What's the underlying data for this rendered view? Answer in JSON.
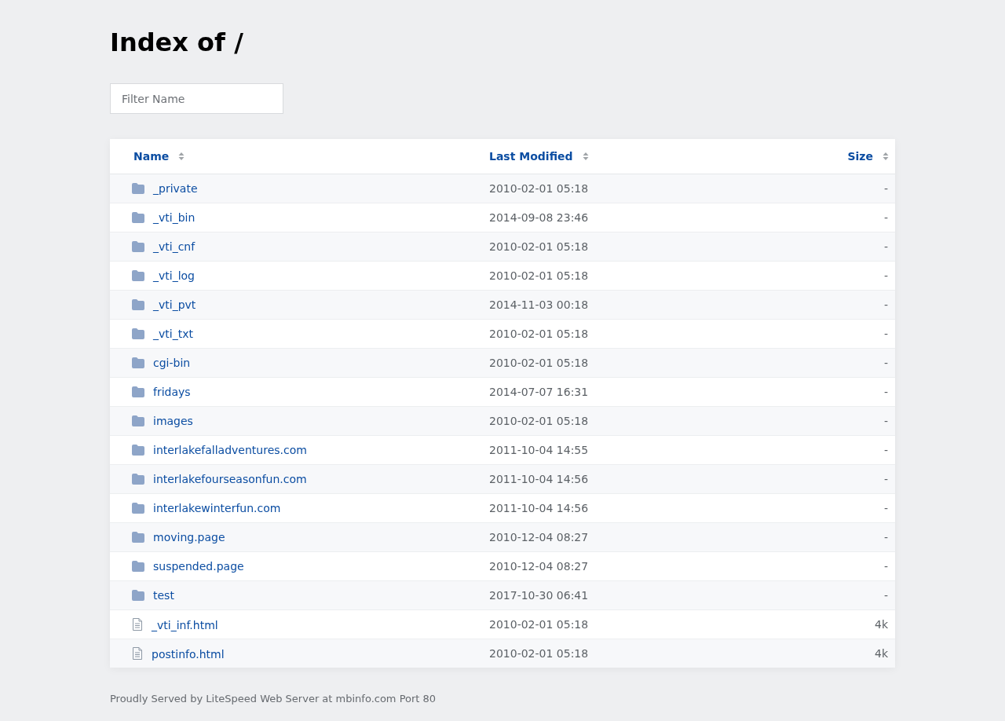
{
  "title": "Index of /",
  "filter": {
    "placeholder": "Filter Name"
  },
  "columns": [
    {
      "label": "Name"
    },
    {
      "label": "Last Modified"
    },
    {
      "label": "Size"
    }
  ],
  "rows": [
    {
      "kind": "folder",
      "name": "_private",
      "modified": "2010-02-01 05:18",
      "size": "-"
    },
    {
      "kind": "folder",
      "name": "_vti_bin",
      "modified": "2014-09-08 23:46",
      "size": "-"
    },
    {
      "kind": "folder",
      "name": "_vti_cnf",
      "modified": "2010-02-01 05:18",
      "size": "-"
    },
    {
      "kind": "folder",
      "name": "_vti_log",
      "modified": "2010-02-01 05:18",
      "size": "-"
    },
    {
      "kind": "folder",
      "name": "_vti_pvt",
      "modified": "2014-11-03 00:18",
      "size": "-"
    },
    {
      "kind": "folder",
      "name": "_vti_txt",
      "modified": "2010-02-01 05:18",
      "size": "-"
    },
    {
      "kind": "folder",
      "name": "cgi-bin",
      "modified": "2010-02-01 05:18",
      "size": "-"
    },
    {
      "kind": "folder",
      "name": "fridays",
      "modified": "2014-07-07 16:31",
      "size": "-"
    },
    {
      "kind": "folder",
      "name": "images",
      "modified": "2010-02-01 05:18",
      "size": "-"
    },
    {
      "kind": "folder",
      "name": "interlakefalladventures.com",
      "modified": "2011-10-04 14:55",
      "size": "-"
    },
    {
      "kind": "folder",
      "name": "interlakefourseasonfun.com",
      "modified": "2011-10-04 14:56",
      "size": "-"
    },
    {
      "kind": "folder",
      "name": "interlakewinterfun.com",
      "modified": "2011-10-04 14:56",
      "size": "-"
    },
    {
      "kind": "folder",
      "name": "moving.page",
      "modified": "2010-12-04 08:27",
      "size": "-"
    },
    {
      "kind": "folder",
      "name": "suspended.page",
      "modified": "2010-12-04 08:27",
      "size": "-"
    },
    {
      "kind": "folder",
      "name": "test",
      "modified": "2017-10-30 06:41",
      "size": "-"
    },
    {
      "kind": "file",
      "name": "_vti_inf.html",
      "modified": "2010-02-01 05:18",
      "size": "4k"
    },
    {
      "kind": "file",
      "name": "postinfo.html",
      "modified": "2010-02-01 05:18",
      "size": "4k"
    }
  ],
  "footer": "Proudly Served by LiteSpeed Web Server at mbinfo.com Port 80"
}
